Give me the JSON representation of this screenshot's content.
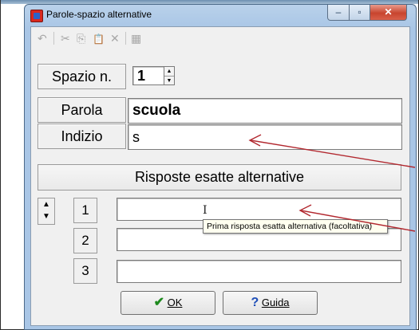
{
  "window": {
    "title": "Parole-spazio alternative",
    "caption_buttons": {
      "minimize": "–",
      "maximize": "▫",
      "close": "✕"
    }
  },
  "toolbar": {
    "icons": [
      "undo-icon",
      "cut-icon",
      "copy-icon",
      "paste-icon",
      "delete-icon",
      "table-icon"
    ],
    "glyphs": {
      "undo": "↶",
      "cut": "✂",
      "copy": "⎘",
      "paste": "📋",
      "delete": "✕",
      "table": "▦"
    }
  },
  "form": {
    "spazio_label": "Spazio n.",
    "spazio_value": "1",
    "parola_label": "Parola",
    "parola_value": "scuola",
    "indizio_label": "Indizio",
    "indizio_value": "s",
    "risposte_button": "Risposte esatte alternative",
    "answers": [
      {
        "number": "1",
        "value": ""
      },
      {
        "number": "2",
        "value": ""
      },
      {
        "number": "3",
        "value": ""
      }
    ]
  },
  "tooltip": {
    "text": "Prima risposta esatta alternativa (facoltativa)"
  },
  "buttons": {
    "ok_label": "OK",
    "help_label": "Guida"
  },
  "colors": {
    "annotation_arrow": "#b2282f",
    "ok_check": "#1e8a1e",
    "help_question": "#1f4fb8"
  }
}
